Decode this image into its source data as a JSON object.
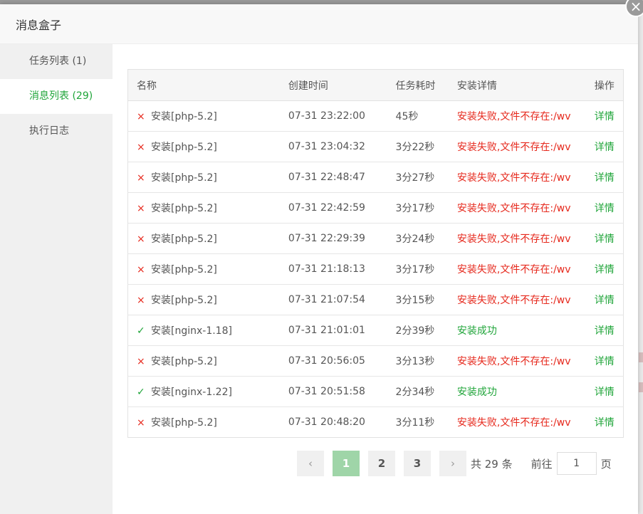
{
  "modal": {
    "title": "消息盒子"
  },
  "close_icon": "×",
  "sidebar": {
    "items": [
      {
        "label": "任务列表 (1)"
      },
      {
        "label": "消息列表 (29)"
      },
      {
        "label": "执行日志"
      }
    ],
    "active_index": 1
  },
  "table": {
    "headers": [
      "名称",
      "创建时间",
      "任务耗时",
      "安装详情",
      "操作"
    ],
    "rows": [
      {
        "status": "fail",
        "icon": "×",
        "name": "安装[php-5.2]",
        "time": "07-31 23:22:00",
        "duration": "45秒",
        "detail": "安装失败,文件不存在:/wv",
        "action": "详情"
      },
      {
        "status": "fail",
        "icon": "×",
        "name": "安装[php-5.2]",
        "time": "07-31 23:04:32",
        "duration": "3分22秒",
        "detail": "安装失败,文件不存在:/wv",
        "action": "详情"
      },
      {
        "status": "fail",
        "icon": "×",
        "name": "安装[php-5.2]",
        "time": "07-31 22:48:47",
        "duration": "3分27秒",
        "detail": "安装失败,文件不存在:/wv",
        "action": "详情"
      },
      {
        "status": "fail",
        "icon": "×",
        "name": "安装[php-5.2]",
        "time": "07-31 22:42:59",
        "duration": "3分17秒",
        "detail": "安装失败,文件不存在:/wv",
        "action": "详情"
      },
      {
        "status": "fail",
        "icon": "×",
        "name": "安装[php-5.2]",
        "time": "07-31 22:29:39",
        "duration": "3分24秒",
        "detail": "安装失败,文件不存在:/wv",
        "action": "详情"
      },
      {
        "status": "fail",
        "icon": "×",
        "name": "安装[php-5.2]",
        "time": "07-31 21:18:13",
        "duration": "3分17秒",
        "detail": "安装失败,文件不存在:/wv",
        "action": "详情"
      },
      {
        "status": "fail",
        "icon": "×",
        "name": "安装[php-5.2]",
        "time": "07-31 21:07:54",
        "duration": "3分15秒",
        "detail": "安装失败,文件不存在:/wv",
        "action": "详情"
      },
      {
        "status": "ok",
        "icon": "✓",
        "name": "安装[nginx-1.18]",
        "time": "07-31 21:01:01",
        "duration": "2分39秒",
        "detail": "安装成功",
        "action": "详情"
      },
      {
        "status": "fail",
        "icon": "×",
        "name": "安装[php-5.2]",
        "time": "07-31 20:56:05",
        "duration": "3分13秒",
        "detail": "安装失败,文件不存在:/wv",
        "action": "详情"
      },
      {
        "status": "ok",
        "icon": "✓",
        "name": "安装[nginx-1.22]",
        "time": "07-31 20:51:58",
        "duration": "2分34秒",
        "detail": "安装成功",
        "action": "详情"
      },
      {
        "status": "fail",
        "icon": "×",
        "name": "安装[php-5.2]",
        "time": "07-31 20:48:20",
        "duration": "3分11秒",
        "detail": "安装失败,文件不存在:/wv",
        "action": "详情"
      }
    ]
  },
  "pagination": {
    "prev_icon": "‹",
    "next_icon": "›",
    "pages": [
      "1",
      "2",
      "3"
    ],
    "current": "1",
    "total_label": "共 29 条",
    "goto_label": "前往",
    "goto_value": "1",
    "page_suffix": "页"
  },
  "colors": {
    "success": "#20a53a",
    "error": "#e6281c",
    "active_page": "#9fd5a8"
  }
}
